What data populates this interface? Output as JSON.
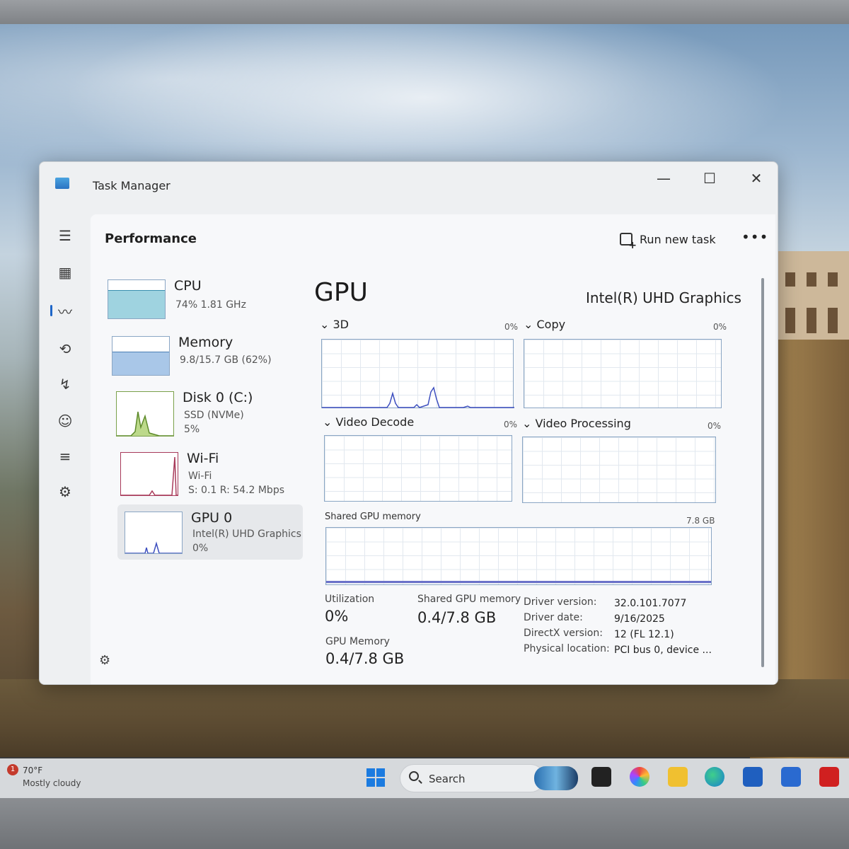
{
  "window": {
    "title": "Task Manager",
    "minimize": "—",
    "maximize": "☐",
    "close": "✕"
  },
  "header": {
    "title": "Performance",
    "run_task": "Run new task",
    "more": "•••"
  },
  "devices": [
    {
      "name": "CPU",
      "sub1": "74%  1.81 GHz",
      "sub2": ""
    },
    {
      "name": "Memory",
      "sub1": "9.8/15.7 GB (62%)",
      "sub2": ""
    },
    {
      "name": "Disk 0 (C:)",
      "sub1": "SSD (NVMe)",
      "sub2": "5%"
    },
    {
      "name": "Wi-Fi",
      "sub1": "Wi-Fi",
      "sub2": "S: 0.1  R: 54.2 Mbps"
    },
    {
      "name": "GPU 0",
      "sub1": "Intel(R) UHD Graphics",
      "sub2": "0%"
    }
  ],
  "gpu": {
    "title": "GPU",
    "model": "Intel(R) UHD Graphics",
    "engines": [
      {
        "label": "3D",
        "pct": "0%"
      },
      {
        "label": "Copy",
        "pct": "0%"
      },
      {
        "label": "Video Decode",
        "pct": "0%"
      },
      {
        "label": "Video Processing",
        "pct": "0%"
      }
    ],
    "shared_label": "Shared GPU memory",
    "shared_max": "7.8 GB",
    "stats": {
      "util_label": "Utilization",
      "util_value": "0%",
      "shared_label": "Shared GPU memory",
      "shared_value": "0.4/7.8 GB",
      "mem_label": "GPU Memory",
      "mem_value": "0.4/7.8 GB"
    },
    "details": [
      {
        "k": "Driver version:",
        "v": "32.0.101.7077"
      },
      {
        "k": "Driver date:",
        "v": "9/16/2025"
      },
      {
        "k": "DirectX version:",
        "v": "12 (FL 12.1)"
      },
      {
        "k": "Physical location:",
        "v": "PCI bus 0, device ..."
      }
    ]
  },
  "taskbar": {
    "badge": "1",
    "temp": "70°F",
    "condition": "Mostly cloudy",
    "search": "Search"
  },
  "colors": {
    "accent": "#1e66c8",
    "cpu_fill": "#9fd3e0",
    "mem_fill": "#a9c7e8",
    "disk_fill": "#9cc45a",
    "wifi_line": "#a83a5a",
    "gpu_line": "#3d4fbf"
  }
}
